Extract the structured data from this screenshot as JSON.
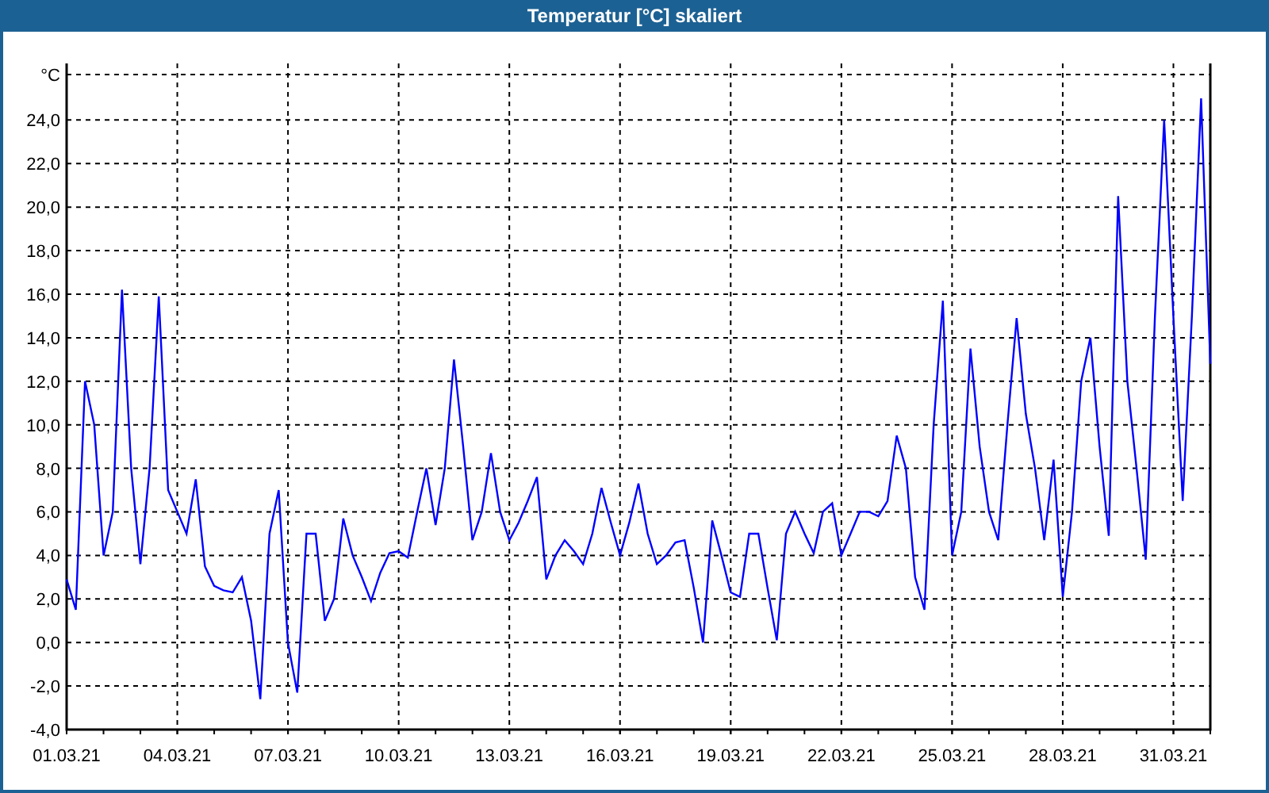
{
  "window": {
    "title": "Temperatur [°C] skaliert"
  },
  "chart": {
    "chart_data": {
      "type": "line",
      "grid": true,
      "ylabel": "°C",
      "ylim": [
        -4,
        26.6
      ],
      "categories": [
        "01.03.21",
        null,
        null,
        null,
        null,
        null,
        null,
        null,
        null,
        null,
        null,
        null,
        "04.03.21",
        null,
        null,
        null,
        null,
        null,
        null,
        null,
        null,
        null,
        null,
        null,
        "07.03.21",
        null,
        null,
        null,
        null,
        null,
        null,
        null,
        null,
        null,
        null,
        null,
        "10.03.21",
        null,
        null,
        null,
        null,
        null,
        null,
        null,
        null,
        null,
        null,
        null,
        "13.03.21",
        null,
        null,
        null,
        null,
        null,
        null,
        null,
        null,
        null,
        null,
        null,
        "16.03.21",
        null,
        null,
        null,
        null,
        null,
        null,
        null,
        null,
        null,
        null,
        null,
        "19.03.21",
        null,
        null,
        null,
        null,
        null,
        null,
        null,
        null,
        null,
        null,
        null,
        "22.03.21",
        null,
        null,
        null,
        null,
        null,
        null,
        null,
        null,
        null,
        null,
        null,
        "25.03.21",
        null,
        null,
        null,
        null,
        null,
        null,
        null,
        null,
        null,
        null,
        null,
        "28.03.21",
        null,
        null,
        null,
        null,
        null,
        null,
        null,
        null,
        null,
        null,
        null,
        "31.03.21",
        null,
        null,
        null,
        null
      ],
      "series": [
        {
          "color": "#0000ff",
          "values": [
            2.9,
            1.5,
            12.0,
            10.0,
            4.0,
            6.0,
            16.2,
            8.0,
            3.6,
            8.0,
            15.9,
            7.0,
            6.0,
            5.0,
            7.5,
            3.5,
            2.6,
            2.4,
            2.3,
            3.0,
            1.0,
            -2.6,
            5.0,
            7.0,
            0.0,
            -2.3,
            5.0,
            5.0,
            1.0,
            2.0,
            5.7,
            4.0,
            3.0,
            1.9,
            3.2,
            4.1,
            4.2,
            3.9,
            6.0,
            8.0,
            5.4,
            8.0,
            13.0,
            9.0,
            4.7,
            6.0,
            8.7,
            6.0,
            4.7,
            5.5,
            6.5,
            7.6,
            2.9,
            4.0,
            4.7,
            4.2,
            3.6,
            5.0,
            7.1,
            5.5,
            4.0,
            5.5,
            7.3,
            5.0,
            3.6,
            4.0,
            4.6,
            4.7,
            2.5,
            0.0,
            5.6,
            4.0,
            2.3,
            2.1,
            5.0,
            5.0,
            2.5,
            0.1,
            5.0,
            6.0,
            5.0,
            4.1,
            6.0,
            6.4,
            4.0,
            5.0,
            6.0,
            6.0,
            5.8,
            6.5,
            9.5,
            8.0,
            3.0,
            1.5,
            10.0,
            15.7,
            4.0,
            6.0,
            13.5,
            9.0,
            6.0,
            4.7,
            10.0,
            14.9,
            10.5,
            8.0,
            4.7,
            8.4,
            2.1,
            6.0,
            12.0,
            14.0,
            9.0,
            4.9,
            20.5,
            12.0,
            8.0,
            3.8,
            15.0,
            24.0,
            15.0,
            6.5,
            15.0,
            25.0,
            12.8
          ]
        }
      ],
      "yticks": [
        {
          "value": -4,
          "label": "-4,0"
        },
        {
          "value": -2,
          "label": "-2,0"
        },
        {
          "value": 0,
          "label": "0,0"
        },
        {
          "value": 2,
          "label": "2,0"
        },
        {
          "value": 4,
          "label": "4,0"
        },
        {
          "value": 6,
          "label": "6,0"
        },
        {
          "value": 8,
          "label": "8,0"
        },
        {
          "value": 10,
          "label": "10,0"
        },
        {
          "value": 12,
          "label": "12,0"
        },
        {
          "value": 14,
          "label": "14,0"
        },
        {
          "value": 16,
          "label": "16,0"
        },
        {
          "value": 18,
          "label": "18,0"
        },
        {
          "value": 20,
          "label": "20,0"
        },
        {
          "value": 22,
          "label": "22,0"
        },
        {
          "value": 24,
          "label": "24,0"
        }
      ]
    }
  }
}
